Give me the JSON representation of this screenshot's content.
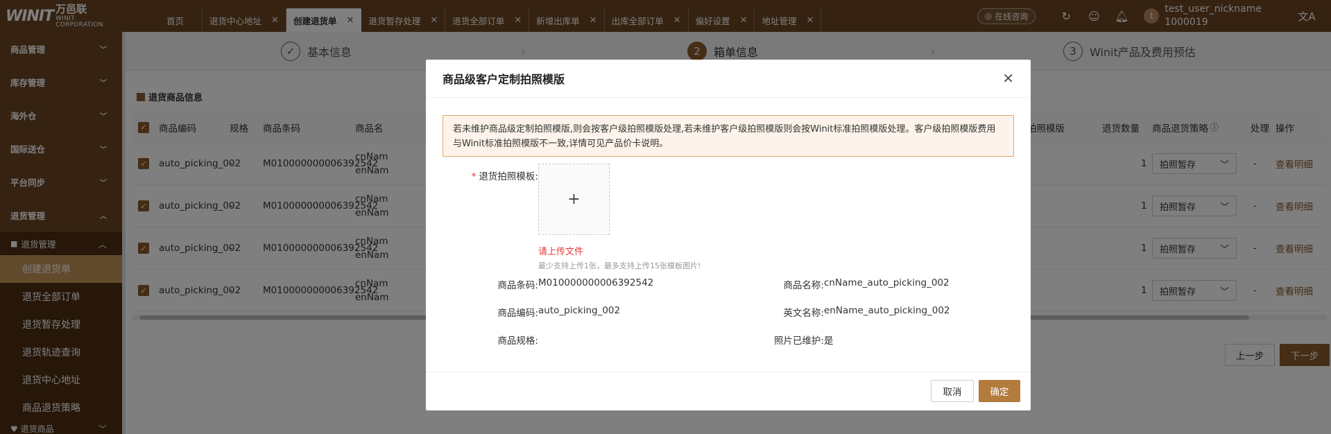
{
  "brand": {
    "mark": "WINIT",
    "cn": "万邑联",
    "en": "WINIT CORPORATION"
  },
  "tabs": [
    {
      "label": "首页",
      "closable": false
    },
    {
      "label": "退货中心地址",
      "closable": true
    },
    {
      "label": "创建退货单",
      "closable": true,
      "active": true
    },
    {
      "label": "退货暂存处理",
      "closable": true
    },
    {
      "label": "退货全部订单",
      "closable": true
    },
    {
      "label": "新增出库单",
      "closable": true
    },
    {
      "label": "出库全部订单",
      "closable": true
    },
    {
      "label": "偏好设置",
      "closable": true
    },
    {
      "label": "地址管理",
      "closable": true
    }
  ],
  "header": {
    "consult_label": "在线咨询",
    "user_name": "test_user_nickname",
    "user_id": "1000019",
    "avatar_letter": "t"
  },
  "sidebar": {
    "groups": [
      "商品管理",
      "库存管理",
      "海外仓",
      "国际送仓",
      "平台同步",
      "退货管理"
    ],
    "sub_group": "退货管理",
    "leaves": [
      "创建退货单",
      "退货全部订单",
      "退货暂存处理",
      "退货轨迹查询",
      "退货中心地址",
      "商品退货策略"
    ],
    "bottom": "退货商品"
  },
  "steps": [
    {
      "num": "✓",
      "label": "基本信息"
    },
    {
      "num": "2",
      "label": "箱单信息"
    },
    {
      "num": "3",
      "label": "Winit产品及费用预估"
    }
  ],
  "section_title": "退货商品信息",
  "table": {
    "headers": [
      "商品编码",
      "规格",
      "商品条码",
      "商品名",
      "拍照模版",
      "退货数量",
      "商品退货策略",
      "处理",
      "操作"
    ],
    "rows": [
      {
        "code": "auto_picking_002",
        "spec": "-",
        "barcode": "M010000000006392542",
        "name1": "cnNam",
        "name2": "enNam",
        "qty": "1",
        "strategy": "拍照暂存",
        "process": "-",
        "op": "查看明细"
      },
      {
        "code": "auto_picking_002",
        "spec": "-",
        "barcode": "M010000000006392542",
        "name1": "cnNam",
        "name2": "enNam",
        "qty": "1",
        "strategy": "拍照暂存",
        "process": "-",
        "op": "查看明细"
      },
      {
        "code": "auto_picking_002",
        "spec": "-",
        "barcode": "M010000000006392542",
        "name1": "cnNam",
        "name2": "enNam",
        "qty": "1",
        "strategy": "拍照暂存",
        "process": "-",
        "op": "查看明细"
      },
      {
        "code": "auto_picking_002",
        "spec": "-",
        "barcode": "M010000000006392542",
        "name1": "cnNam",
        "name2": "enNam",
        "qty": "1",
        "strategy": "拍照暂存",
        "process": "-",
        "op": "查看明细"
      }
    ]
  },
  "page_buttons": {
    "prev": "上一步",
    "next": "下一步"
  },
  "modal": {
    "title": "商品级客户定制拍照模版",
    "notice": "若未维护商品级定制拍照模版,则会按客户级拍照模版处理,若未维护客户级拍照模版则会按Winit标准拍照模版处理。客户级拍照模版费用与Winit标准拍照模版不一致,详情可见产品价卡说明。",
    "upload_label": "退货拍照模板:",
    "upload_error": "请上传文件",
    "upload_hint": "最少支持上传1张，最多支持上传15张模板图片!",
    "fields": {
      "barcode_label": "商品条码:",
      "barcode_value": "M010000000006392542",
      "name_label": "商品名称:",
      "name_value": "cnName_auto_picking_002",
      "code_label": "商品编码:",
      "code_value": "auto_picking_002",
      "en_label": "英文名称:",
      "en_value": "enName_auto_picking_002",
      "spec_label": "商品规格:",
      "spec_value": "",
      "photo_label": "照片已维护:",
      "photo_value": "是"
    },
    "cancel": "取消",
    "ok": "确定"
  },
  "colors": {
    "brand_brown": "#6b4420",
    "accent": "#8a5a2c",
    "ok_button": "#b37b3c",
    "error": "#e4393c"
  }
}
